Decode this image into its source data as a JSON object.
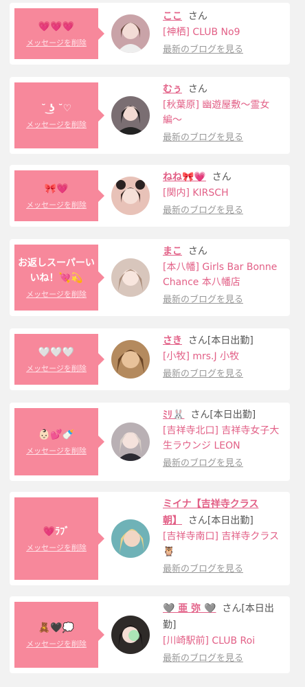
{
  "cards": [
    {
      "message": "💗💗💗",
      "delete_label": "メッセージを削除",
      "name": "ここ",
      "suffix": "さん",
      "shop": "[神栖] CLUB No9",
      "blog_link": "最新のブログを見る",
      "avatar_color": "#c9a3a8"
    },
    {
      "message": "˘ ͜ʖ ˘♡",
      "delete_label": "メッセージを削除",
      "name": "むぅ",
      "suffix": "さん",
      "shop": "[秋葉原] 幽遊屋敷〜霊女編〜",
      "blog_link": "最新のブログを見る",
      "avatar_color": "#7a6e72"
    },
    {
      "message": "🎀💗",
      "delete_label": "メッセージを削除",
      "name": "ねね🎀💗",
      "suffix": "さん",
      "shop": "[関内] KIRSCH",
      "blog_link": "最新のブログを見る",
      "avatar_color": "#e8c2b8"
    },
    {
      "message": "お返しスーパーいいね！💘💫",
      "delete_label": "メッセージを削除",
      "name": "まこ",
      "suffix": "さん",
      "shop": "[本八幡] Girls Bar Bonne Chance 本八幡店",
      "blog_link": "最新のブログを見る",
      "avatar_color": "#d8c6bc"
    },
    {
      "message": "🤍🤍🤍",
      "delete_label": "メッセージを削除",
      "name": "さき",
      "suffix": "さん[本日出勤]",
      "shop": "[小牧] mrs.J 小牧",
      "blog_link": "最新のブログを見る",
      "avatar_color": "#b48a5e"
    },
    {
      "message": "👶🏻💕🍼",
      "delete_label": "メッセージを削除",
      "name": "ﾐﾘ🐰",
      "suffix": "さん[本日出勤]",
      "shop": "[吉祥寺北口] 吉祥寺女子大生ラウンジ LEON",
      "blog_link": "最新のブログを見る",
      "avatar_color": "#b9b0b4"
    },
    {
      "message": "💗ﾗﾌﾞ",
      "delete_label": "メッセージを削除",
      "name": "ミイナ【吉祥寺クラス朝】",
      "suffix": "さん[本日出勤]",
      "shop": "[吉祥寺南口] 吉祥寺クラス🦉",
      "blog_link": "最新のブログを見る",
      "avatar_color": "#6fb2b7"
    },
    {
      "message": "🧸🖤💭",
      "delete_label": "メッセージを削除",
      "name": "🩶 亜 弥 🩶",
      "suffix": "さん[本日出勤]",
      "shop": "[川崎駅前] CLUB Roi",
      "blog_link": "最新のブログを見る",
      "avatar_color": "#2e2a28"
    }
  ]
}
